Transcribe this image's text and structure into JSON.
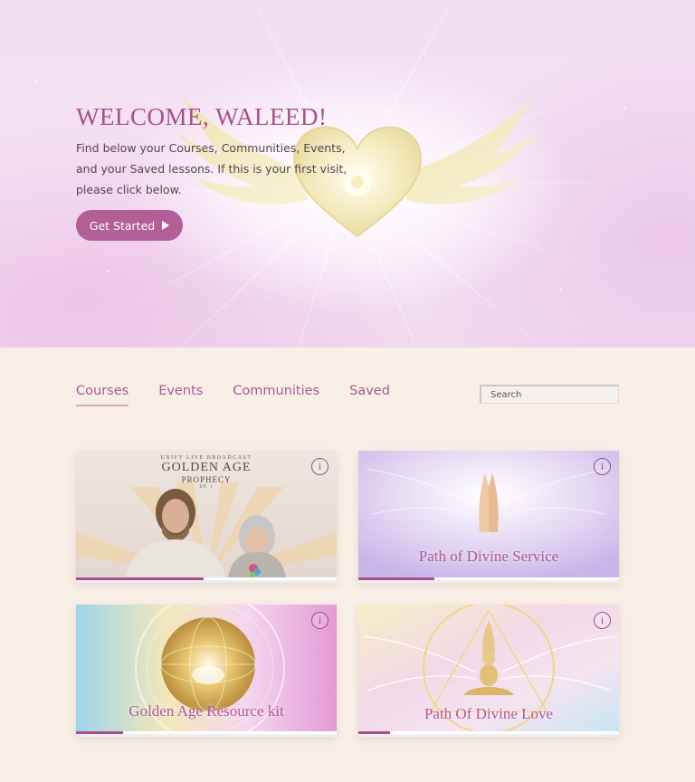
{
  "hero": {
    "title": "WELCOME, WALEED!",
    "text": "Find below your Courses, Communities, Events, and your Saved lessons. If this is your first visit, please click below.",
    "button_label": "Get Started"
  },
  "tabs": [
    {
      "label": "Courses",
      "active": true
    },
    {
      "label": "Events",
      "active": false
    },
    {
      "label": "Communities",
      "active": false
    },
    {
      "label": "Saved",
      "active": false
    }
  ],
  "search": {
    "placeholder": "Search"
  },
  "cards": [
    {
      "title": "Golden Age Prophecy",
      "subtitle_top": "UNIFY LIVE BROADCAST",
      "line1": "GOLDEN AGE",
      "line2": "PROPHECY",
      "line3": "EP. 1",
      "progress": 0.49
    },
    {
      "title": "Path of Divine Service",
      "progress": 0.29
    },
    {
      "title": "Golden Age Resource kit",
      "progress": 0.18
    },
    {
      "title": "Path Of Divine Love",
      "progress": 0.12
    }
  ],
  "icons": {
    "info": "i"
  },
  "colors": {
    "accent": "#b25f98",
    "text_accent": "#a8508f",
    "background": "#f8efe6"
  }
}
